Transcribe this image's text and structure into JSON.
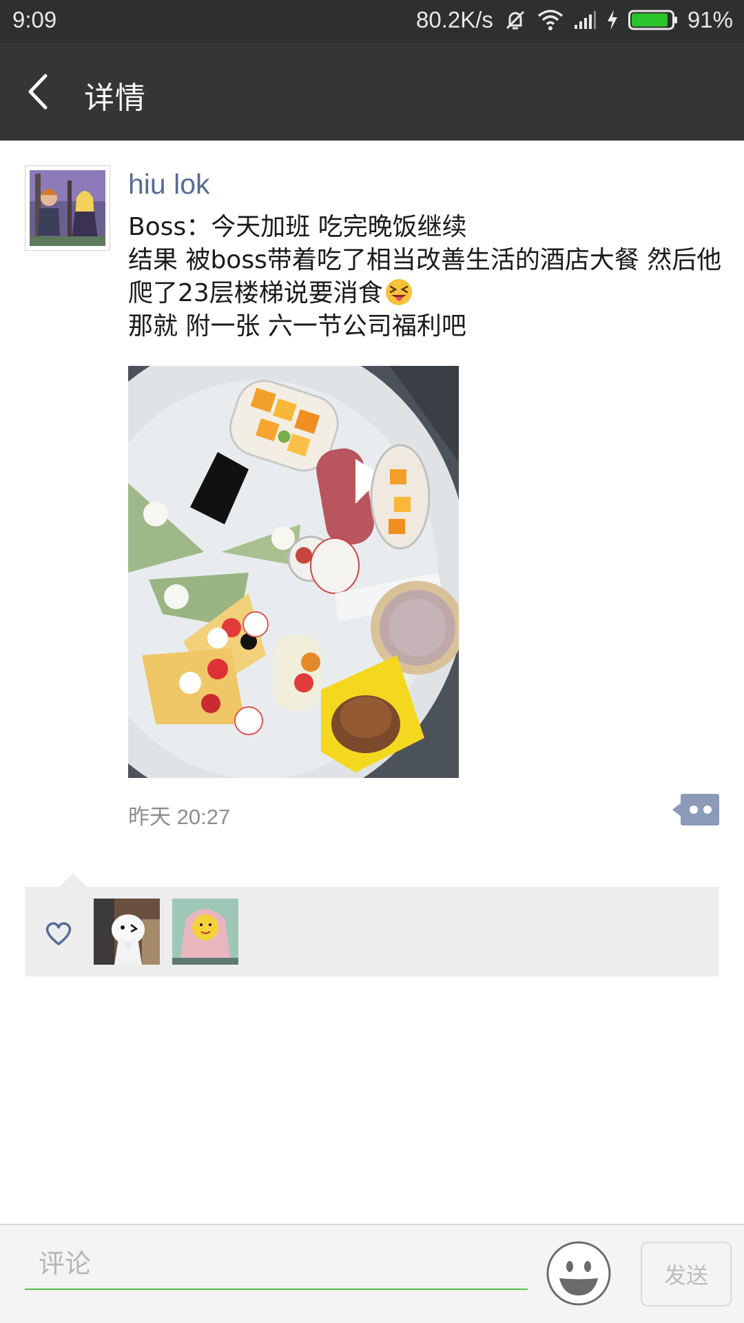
{
  "status_bar": {
    "time": "9:09",
    "network_speed": "80.2K/s",
    "battery": "91%",
    "battery_level": 0.91,
    "icons": [
      "mute-icon",
      "wifi-icon",
      "signal-icon",
      "charging-icon",
      "battery-icon"
    ],
    "battery_color": "#2bc52b"
  },
  "header": {
    "title": "详情",
    "back_icon": "chevron-left-icon"
  },
  "post": {
    "username": "hiu lok",
    "username_color": "#576b95",
    "lines": [
      "Boss：今天加班 吃完晚饭继续",
      "结果 被boss带着吃了相当改善生活的酒店大餐 然后他",
      "爬了23层楼梯说要消食",
      "那就 附一张 六一节公司福利吧"
    ],
    "emoji": "squinting-tongue-emoji",
    "photo": "dessert-platter-photo",
    "timestamp": "昨天 20:27",
    "more_icon": "comment-more-icon"
  },
  "likes": {
    "icon": "heart-icon",
    "avatars": [
      "liker-avatar-1",
      "liker-avatar-2"
    ]
  },
  "bottom_bar": {
    "comment_placeholder": "评论",
    "emoji_icon": "smiley-icon",
    "send_label": "发送",
    "accent_color": "#4cc04c"
  }
}
